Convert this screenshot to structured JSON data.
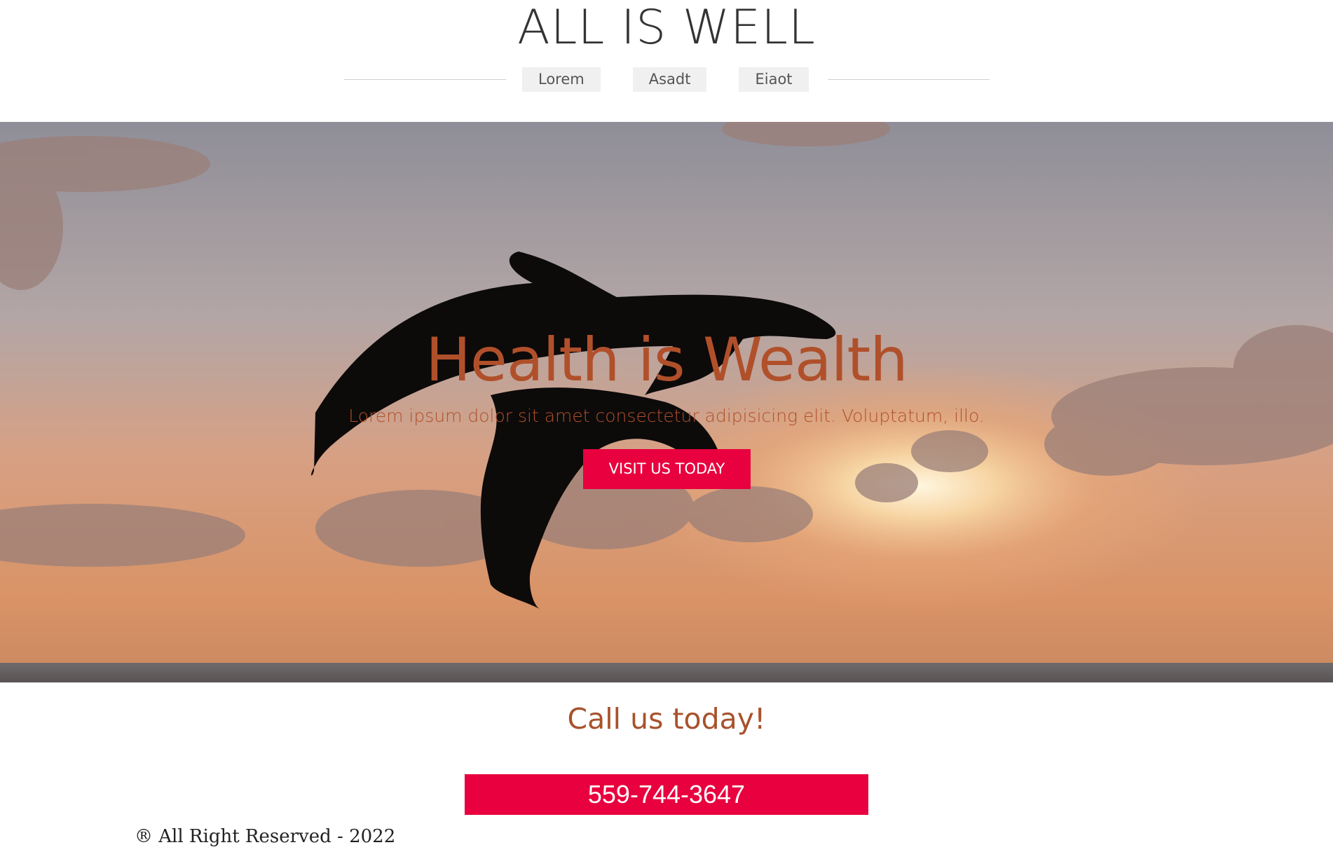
{
  "header": {
    "site_title": "ALL IS WELL",
    "nav": [
      {
        "label": "Lorem"
      },
      {
        "label": "Asadt"
      },
      {
        "label": "Eiaot"
      }
    ]
  },
  "hero": {
    "title": "Health is Wealth",
    "subtitle": "Lorem ipsum dolor sit amet consectetur adipisicing elit. Voluptatum, illo.",
    "cta_label": "VISIT US TODAY",
    "background": "dolphins-sunset-photo"
  },
  "contact": {
    "heading": "Call us today!",
    "phone": "559-744-3647"
  },
  "footer": {
    "copyright": "® All Right Reserved - 2022"
  },
  "colors": {
    "accent": "#e8003f",
    "headline": "#b0502b",
    "title": "#333333",
    "nav_bg": "#f0f0f0"
  }
}
